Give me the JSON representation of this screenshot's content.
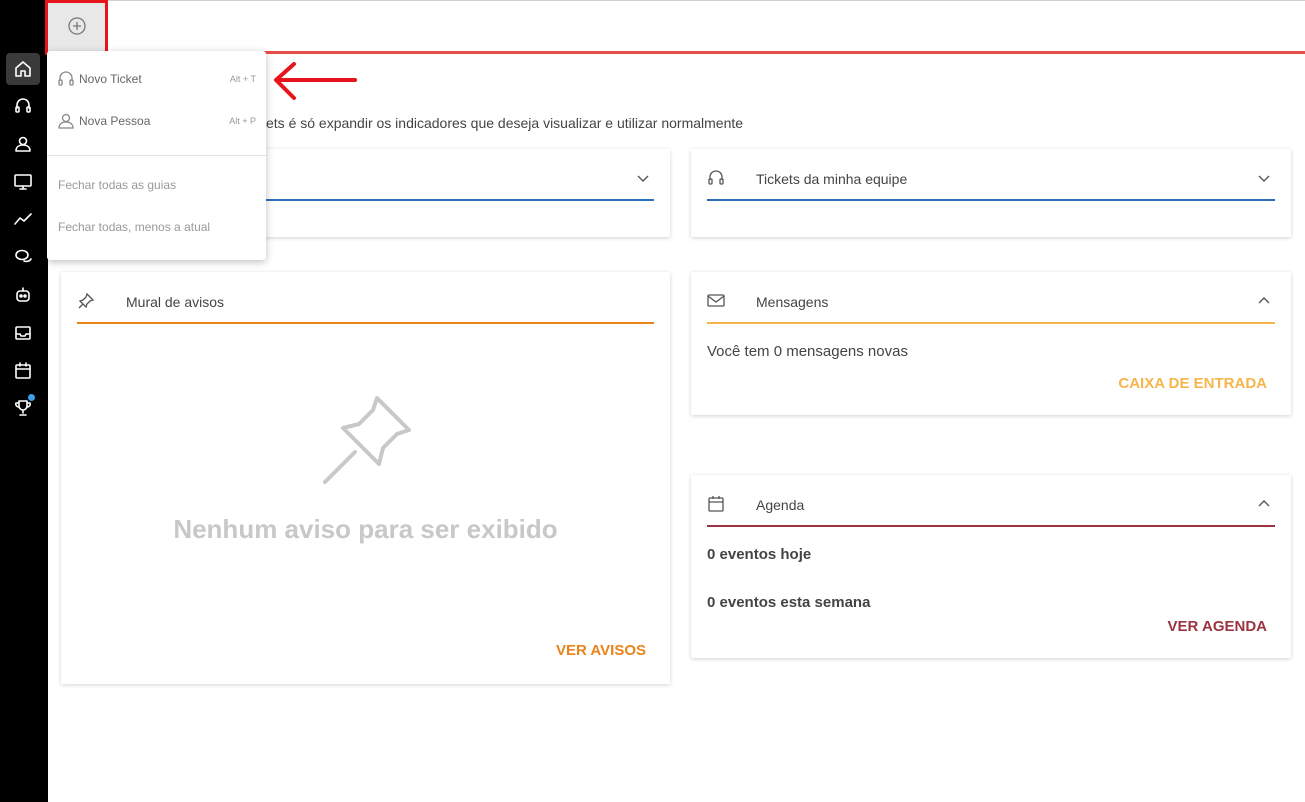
{
  "sidebar": {
    "items": [
      {
        "icon": "home-icon",
        "active": true
      },
      {
        "icon": "headset-icon"
      },
      {
        "icon": "people-icon"
      },
      {
        "icon": "monitor-icon"
      },
      {
        "icon": "trending-icon"
      },
      {
        "icon": "chat-icon"
      },
      {
        "icon": "robot-icon"
      },
      {
        "icon": "inbox-icon"
      },
      {
        "icon": "calendar-icon"
      },
      {
        "icon": "trophy-icon"
      }
    ]
  },
  "dropdown": {
    "new_ticket_label": "Novo Ticket",
    "new_ticket_shortcut": "Alt + T",
    "new_person_label": "Nova Pessoa",
    "new_person_shortcut": "Alt + P",
    "close_all_label": "Fechar todas as guias",
    "close_others_label": "Fechar todas, menos a atual"
  },
  "intro_text": "ckets é só expandir os indicadores que deseja visualizar e utilizar normalmente",
  "cards": {
    "team_tickets": {
      "title": "Tickets da minha equipe",
      "accent": "#2a6ebb"
    },
    "notices": {
      "title": "Mural de avisos",
      "accent": "#e8841a",
      "empty_text": "Nenhum aviso para ser exibido",
      "link": "VER AVISOS"
    },
    "messages": {
      "title": "Mensagens",
      "accent": "#f5b54a",
      "text": "Você tem 0 mensagens novas",
      "link": "CAIXA DE ENTRADA"
    },
    "agenda": {
      "title": "Agenda",
      "accent": "#9a3440",
      "today": "0 eventos hoje",
      "week": "0 eventos esta semana",
      "link": "VER AGENDA"
    }
  },
  "colors": {
    "topbar_line": "#e84c4c",
    "highlight": "#e8141c",
    "sidebar_bg": "#000000"
  }
}
